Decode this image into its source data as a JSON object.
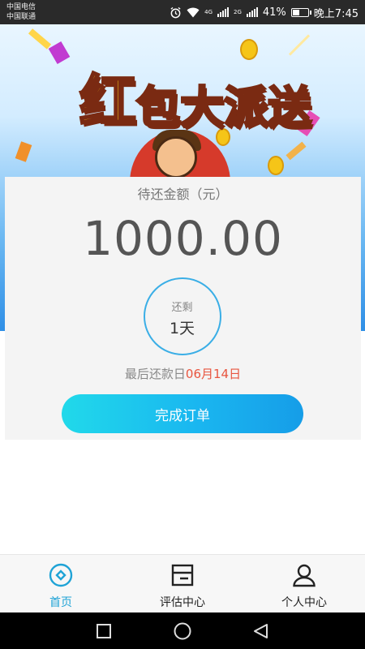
{
  "status_bar": {
    "carrier_1": "中国电信",
    "carrier_2": "中国联通",
    "network_1": "4G",
    "network_2": "2G",
    "battery": "41%",
    "battery_level": 0.41,
    "time": "晚上7:45"
  },
  "banner": {
    "title_chars": [
      "红",
      "包",
      "大",
      "派",
      "送"
    ]
  },
  "repayment": {
    "amount_label": "待还金额（元）",
    "amount": "1000.00",
    "remain_label": "还剩",
    "remain_value": "1天",
    "due_prefix": "最后还款日",
    "due_date": "06月14日",
    "finish_button": "完成订单"
  },
  "bottom_nav": {
    "items": [
      {
        "label": "首页",
        "icon": "home-icon",
        "active": true
      },
      {
        "label": "评估中心",
        "icon": "assessment-icon",
        "active": false
      },
      {
        "label": "个人中心",
        "icon": "person-icon",
        "active": false
      }
    ]
  },
  "colors": {
    "accent": "#1fa3d6",
    "button_start": "#21d9ea",
    "button_end": "#169de8",
    "due_date": "#e8553f"
  }
}
